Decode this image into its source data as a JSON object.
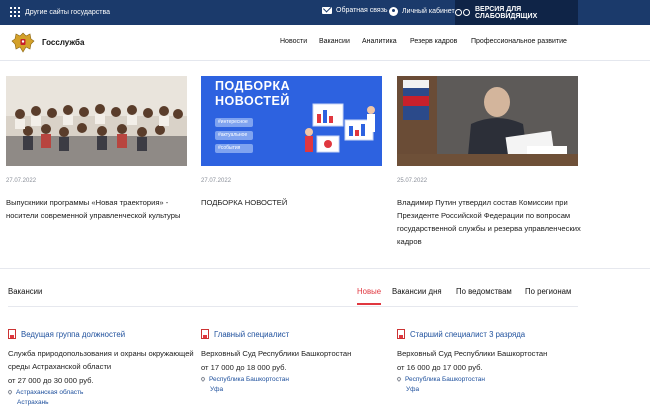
{
  "topbar": {
    "other_sites": "Другие сайты государства",
    "feedback": "Обратная связь",
    "cabinet": "Личный кабинет",
    "vision_version": "ВЕРСИЯ ДЛЯ СЛАБОВИДЯЩИХ"
  },
  "header": {
    "brand": "Госслужба",
    "nav": [
      "Новости",
      "Вакансии",
      "Аналитика",
      "Резерв кадров",
      "Профессиональное развитие"
    ]
  },
  "news": [
    {
      "date": "27.07.2022",
      "title": "Выпускники программы «Новая траектория» - носители современной управленческой культуры"
    },
    {
      "date": "27.07.2022",
      "title": "ПОДБОРКА НОВОСТЕЙ",
      "image_heading": "ПОДБОРКА НОВОСТЕЙ",
      "image_tags": [
        "#интересное",
        "#актуальное",
        "#события"
      ]
    },
    {
      "date": "25.07.2022",
      "title": "Владимир Путин утвердил состав Комиссии при Президенте Российской Федерации по вопросам государственной службы и резерва управленческих кадров"
    }
  ],
  "vacancies": {
    "heading": "Вакансии",
    "tabs": [
      "Новые",
      "Вакансии дня",
      "По ведомствам",
      "По регионам"
    ],
    "active_tab": "Новые",
    "items": [
      {
        "title": "Ведущая группа должностей",
        "org": "Служба природопользования и охраны окружающей среды Астраханской области",
        "salary": "от 27 000 до 30 000 руб.",
        "region": "Астраханская область",
        "city": "Астрахань"
      },
      {
        "title": "Главный специалист",
        "org": "Верховный Суд Республики Башкортостан",
        "salary": "от 17 000 до 18 000 руб.",
        "region": "Республика Башкортостан",
        "city": "Уфа"
      },
      {
        "title": "Старший специалист 3 разряда",
        "org": "Верховный Суд Республики Башкортостан",
        "salary": "от 16 000 до 17 000 руб.",
        "region": "Республика Башкортостан",
        "city": "Уфа"
      }
    ]
  },
  "colors": {
    "topbar": "#1b3a6b",
    "accent": "#e0373f",
    "link": "#1d4f9c"
  }
}
